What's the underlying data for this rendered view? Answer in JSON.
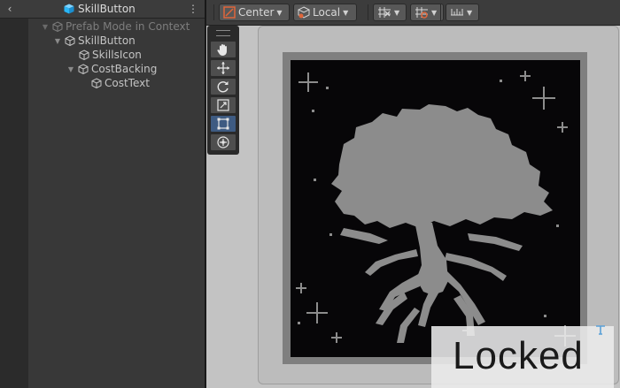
{
  "hierarchy": {
    "title": "SkillButton",
    "items": [
      {
        "label": "Prefab Mode in Context",
        "expanded": true,
        "dim": true
      },
      {
        "label": "SkillButton",
        "expanded": true,
        "dim": false
      },
      {
        "label": "SkillsIcon",
        "expanded": false,
        "dim": false
      },
      {
        "label": "CostBacking",
        "expanded": true,
        "dim": false
      },
      {
        "label": "CostText",
        "expanded": false,
        "dim": false
      }
    ]
  },
  "toolbar": {
    "pivot_mode": "Center",
    "pivot_rotation": "Local"
  },
  "tools": {
    "active": "rect-tool"
  },
  "scene": {
    "overlay_text": "Locked"
  },
  "colors": {
    "hierarchy_bg": "#383838",
    "scene_bg": "#c3c3c3",
    "card_border": "#7f7f7f",
    "card_bg": "#070608",
    "artwork": "#8c8c8c",
    "active_tool": "#3e5b82",
    "prefab_icon": "#29b6f6"
  }
}
